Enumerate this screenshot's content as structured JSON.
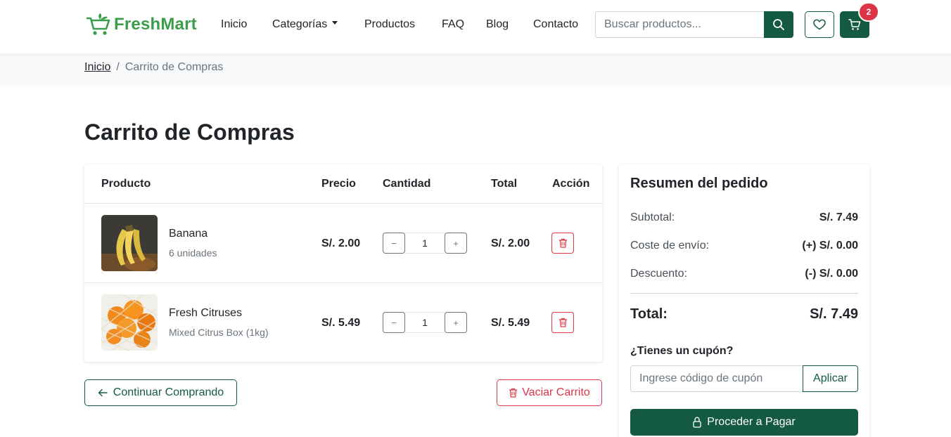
{
  "header": {
    "brand": "FreshMart",
    "nav": [
      "Inicio",
      "Categorías",
      "Productos",
      "FAQ",
      "Blog",
      "Contacto"
    ],
    "search_placeholder": "Buscar productos...",
    "cart_count": "2"
  },
  "breadcrumb": {
    "home": "Inicio",
    "separator": "/",
    "current": "Carrito de Compras"
  },
  "page_title": "Carrito de Compras",
  "cart": {
    "columns": [
      "Producto",
      "Precio",
      "Cantidad",
      "Total",
      "Acción"
    ],
    "items": [
      {
        "name": "Banana",
        "desc": "6 unidades",
        "price": "S/. 2.00",
        "qty": "1",
        "total": "S/. 2.00"
      },
      {
        "name": "Fresh Citruses",
        "desc": "Mixed Citrus Box (1kg)",
        "price": "S/. 5.49",
        "qty": "1",
        "total": "S/. 5.49"
      }
    ],
    "minus": "−",
    "plus": "+",
    "continue_label": "Continuar Comprando",
    "clear_label": "Vaciar Carrito"
  },
  "summary": {
    "title": "Resumen del pedido",
    "subtotal_label": "Subtotal:",
    "subtotal_value": "S/. 7.49",
    "shipping_label": "Coste de envío:",
    "shipping_value": "(+) S/. 0.00",
    "discount_label": "Descuento:",
    "discount_value": "(-) S/. 0.00",
    "total_label": "Total:",
    "total_value": "S/. 7.49",
    "coupon_title": "¿Tienes un cupón?",
    "coupon_placeholder": "Ingrese código de cupón",
    "coupon_button": "Aplicar",
    "checkout_label": "Proceder a Pagar"
  },
  "colors": {
    "primary": "#145a40",
    "brand_green": "#3a9d4a",
    "danger": "#dc3545"
  },
  "icons": [
    "cart-logo-icon",
    "search-icon",
    "heart-icon",
    "cart-icon",
    "trash-icon",
    "arrow-left-icon",
    "lock-icon"
  ]
}
